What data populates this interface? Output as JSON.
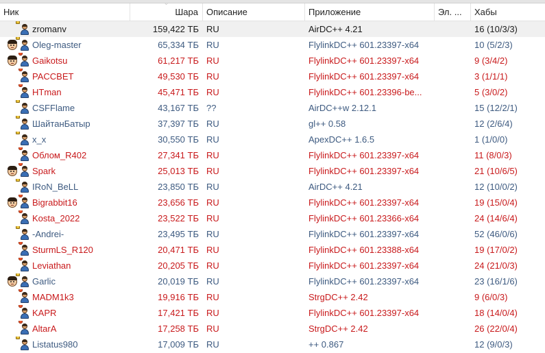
{
  "columns": {
    "nick": "Ник",
    "share": "Шара",
    "description": "Описание",
    "app": "Приложение",
    "email": "Эл. ...",
    "hubs": "Хабы"
  },
  "colors": {
    "blue": "#3d5a80",
    "red": "#c8191b",
    "selected_bg": "#f0f0f0"
  },
  "users": [
    {
      "nick": "zromanv",
      "share": "159,422 ТБ",
      "desc": "RU",
      "app": "AirDC++ 4.21",
      "email": "",
      "hubs": "16 (10/3/3)",
      "color": "dark",
      "avatar": false,
      "selected": true
    },
    {
      "nick": "Oleg-master",
      "share": "65,334 ТБ",
      "desc": "RU",
      "app": "FlylinkDC++ 601.23397-x64",
      "email": "",
      "hubs": "10 (5/2/3)",
      "color": "blue",
      "avatar": true
    },
    {
      "nick": "Gaikotsu",
      "share": "61,217 ТБ",
      "desc": "RU",
      "app": "FlylinkDC++ 601.23397-x64",
      "email": "",
      "hubs": "9 (3/4/2)",
      "color": "red",
      "avatar": true
    },
    {
      "nick": "PACCBET",
      "share": "49,530 ТБ",
      "desc": "RU",
      "app": "FlylinkDC++ 601.23397-x64",
      "email": "",
      "hubs": "3 (1/1/1)",
      "color": "red",
      "avatar": false
    },
    {
      "nick": "HTman",
      "share": "45,471 ТБ",
      "desc": "RU",
      "app": "FlylinkDC++ 601.23396-be...",
      "email": "",
      "hubs": "5 (3/0/2)",
      "color": "red",
      "avatar": false
    },
    {
      "nick": "CSFFlame",
      "share": "43,167 ТБ",
      "desc": "??",
      "app": "AirDC++w 2.12.1",
      "email": "",
      "hubs": "15 (12/2/1)",
      "color": "blue",
      "avatar": false
    },
    {
      "nick": "ШайтанБатыр",
      "share": "37,397 ТБ",
      "desc": "RU",
      "app": "gl++ 0.58",
      "email": "",
      "hubs": "12 (2/6/4)",
      "color": "blue",
      "avatar": false
    },
    {
      "nick": "x_x",
      "share": "30,550 ТБ",
      "desc": "RU",
      "app": "ApexDC++ 1.6.5",
      "email": "",
      "hubs": "1 (1/0/0)",
      "color": "blue",
      "avatar": false
    },
    {
      "nick": "Облом_R402",
      "share": "27,341 ТБ",
      "desc": "RU",
      "app": "FlylinkDC++ 601.23397-x64",
      "email": "",
      "hubs": "11 (8/0/3)",
      "color": "red",
      "avatar": false
    },
    {
      "nick": "Spark",
      "share": "25,013 ТБ",
      "desc": "RU",
      "app": "FlylinkDC++ 601.23397-x64",
      "email": "",
      "hubs": "21 (10/6/5)",
      "color": "red",
      "avatar": true
    },
    {
      "nick": "IRoN_BeLL",
      "share": "23,850 ТБ",
      "desc": "RU",
      "app": "AirDC++ 4.21",
      "email": "",
      "hubs": "12 (10/0/2)",
      "color": "blue",
      "avatar": false
    },
    {
      "nick": "Bigrabbit16",
      "share": "23,656 ТБ",
      "desc": "RU",
      "app": "FlylinkDC++ 601.23397-x64",
      "email": "",
      "hubs": "19 (15/0/4)",
      "color": "red",
      "avatar": true
    },
    {
      "nick": "Kosta_2022",
      "share": "23,522 ТБ",
      "desc": "RU",
      "app": "FlylinkDC++ 601.23366-x64",
      "email": "",
      "hubs": "24 (14/6/4)",
      "color": "red",
      "avatar": false
    },
    {
      "nick": "-Andrei-",
      "share": "23,495 ТБ",
      "desc": "RU",
      "app": "FlylinkDC++ 601.23397-x64",
      "email": "",
      "hubs": "52 (46/0/6)",
      "color": "blue",
      "avatar": false
    },
    {
      "nick": "SturmLS_R120",
      "share": "20,471 ТБ",
      "desc": "RU",
      "app": "FlylinkDC++ 601.23388-x64",
      "email": "",
      "hubs": "19 (17/0/2)",
      "color": "red",
      "avatar": false
    },
    {
      "nick": "Leviathan",
      "share": "20,205 ТБ",
      "desc": "RU",
      "app": "FlylinkDC++ 601.23397-x64",
      "email": "",
      "hubs": "24 (21/0/3)",
      "color": "red",
      "avatar": false
    },
    {
      "nick": "Garlic",
      "share": "20,019 ТБ",
      "desc": "RU",
      "app": "FlylinkDC++ 601.23397-x64",
      "email": "",
      "hubs": "23 (16/1/6)",
      "color": "blue",
      "avatar": true
    },
    {
      "nick": "MADM1k3",
      "share": "19,916 ТБ",
      "desc": "RU",
      "app": "StrgDC++ 2.42",
      "email": "",
      "hubs": "9 (6/0/3)",
      "color": "red",
      "avatar": false
    },
    {
      "nick": "KAPR",
      "share": "17,421 ТБ",
      "desc": "RU",
      "app": "FlylinkDC++ 601.23397-x64",
      "email": "",
      "hubs": "18 (14/0/4)",
      "color": "red",
      "avatar": false
    },
    {
      "nick": "AltarA",
      "share": "17,258 ТБ",
      "desc": "RU",
      "app": "StrgDC++ 2.42",
      "email": "",
      "hubs": "26 (22/0/4)",
      "color": "red",
      "avatar": false
    },
    {
      "nick": "Listatus980",
      "share": "17,009 ТБ",
      "desc": "RU",
      "app": "++ 0.867",
      "email": "",
      "hubs": "12 (9/0/3)",
      "color": "blue",
      "avatar": false
    }
  ]
}
